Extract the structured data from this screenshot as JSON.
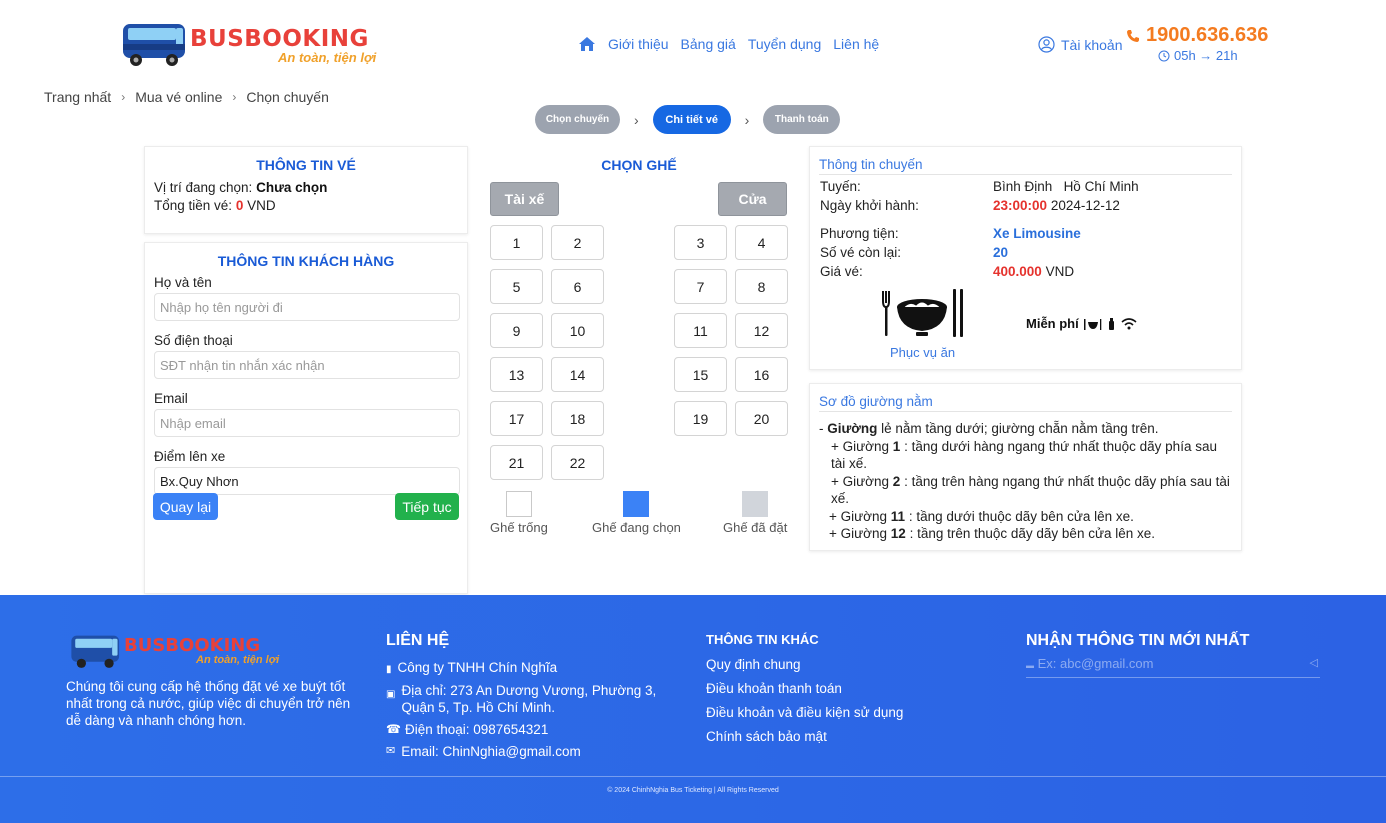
{
  "header": {
    "logo_text": "BUSBOOKING",
    "logo_tagline": "An toàn, tiện lợi",
    "nav": [
      "Giới thiệu",
      "Bảng giá",
      "Tuyển dụng",
      "Liên hệ"
    ],
    "account": "Tài khoản",
    "hotline": "1900.636.636",
    "hours": "05h → 21h"
  },
  "breadcrumb": [
    "Trang nhất",
    "Mua vé online",
    "Chọn chuyến"
  ],
  "steps": [
    "Chọn chuyến",
    "Chi tiết vé",
    "Thanh toán"
  ],
  "ticket_info": {
    "title": "THÔNG TIN VÉ",
    "position_label": "Vị trí đang chọn:",
    "position_value": "Chưa chọn",
    "total_label": "Tổng tiền vé:",
    "total_value": "0",
    "total_unit": "VND"
  },
  "customer": {
    "title": "THÔNG TIN KHÁCH HÀNG",
    "name_label": "Họ và tên",
    "name_placeholder": "Nhập họ tên người đi",
    "phone_label": "Số điện thoại",
    "phone_placeholder": "SĐT nhận tin nhắn xác nhận",
    "email_label": "Email",
    "email_placeholder": "Nhập email",
    "pickup_label": "Điểm lên xe",
    "pickup_value": "Bx.Quy Nhơn",
    "back_button": "Quay lại",
    "next_button": "Tiếp tục"
  },
  "seats": {
    "title": "CHỌN GHẾ",
    "driver": "Tài xế",
    "door": "Cửa",
    "numbers": [
      "1",
      "2",
      "3",
      "4",
      "5",
      "6",
      "7",
      "8",
      "9",
      "10",
      "11",
      "12",
      "13",
      "14",
      "15",
      "16",
      "17",
      "18",
      "19",
      "20",
      "21",
      "22"
    ],
    "legend": [
      {
        "label": "Ghế trống",
        "color": "#ffffff"
      },
      {
        "label": "Ghế đang chọn",
        "color": "#3b82f6"
      },
      {
        "label": "Ghế đã đặt",
        "color": "#d1d5db"
      }
    ]
  },
  "trip": {
    "title": "Thông tin chuyến",
    "route_label": "Tuyến:",
    "route_from": "Bình Định",
    "route_to": "Hồ Chí Minh",
    "date_label": "Ngày khởi hành:",
    "time": "23:00:00",
    "date": "2024-12-12",
    "vehicle_label": "Phương tiện:",
    "vehicle": "Xe Limousine",
    "remaining_label": "Số vé còn lại:",
    "remaining": "20",
    "price_label": "Giá vé:",
    "price": "400.000",
    "price_unit": "VND",
    "meal_caption": "Phục vụ ăn",
    "free_label": "Miễn phí"
  },
  "bed_map": {
    "title": "Sơ đồ giường nằm",
    "lines": [
      {
        "prefix": "- ",
        "bold": "Giường",
        "rest": " lẻ nằm tầng dưới; giường chẵn nằm tầng trên."
      },
      {
        "prefix": "+ Giường ",
        "bold": "1",
        "rest": " : tầng dưới hàng ngang thứ nhất thuộc dãy phía sau tài xế."
      },
      {
        "prefix": "+ Giường ",
        "bold": "2",
        "rest": " : tầng trên hàng ngang thứ nhất thuộc dãy phía sau tài xế."
      },
      {
        "prefix": "+ Giường ",
        "bold": "11",
        "rest": " : tầng dưới thuộc dãy bên cửa lên xe."
      },
      {
        "prefix": "+ Giường ",
        "bold": "12",
        "rest": " : tầng trên thuộc dãy dãy bên cửa lên xe."
      }
    ]
  },
  "footer": {
    "logo_text": "BUSBOOKING",
    "logo_tagline": "An toàn, tiện lợi",
    "about": "Chúng tôi cung cấp hệ thống đặt vé xe buýt tốt nhất trong cả nước, giúp việc di chuyển trở nên dễ dàng và nhanh chóng hơn.",
    "contact_title": "LIÊN HỆ",
    "company": "Công ty TNHH Chín Nghĩa",
    "address": "Địa chỉ: 273 An Dương Vương, Phường 3, Quận 5, Tp. Hồ Chí Minh.",
    "phone": "Điện thoại: 0987654321",
    "email": "Email: ChinNghia@gmail.com",
    "other_title": "THÔNG TIN KHÁC",
    "links": [
      "Quy định chung",
      "Điều khoản thanh toán",
      "Điều khoản và điều kiện sử dụng",
      "Chính sách bảo mật"
    ],
    "newsletter_title": "NHẬN THÔNG TIN MỚI NHẤT",
    "newsletter_placeholder": "Ex: abc@gmail.com",
    "copyright": "© 2024 ChinhNghia Bus Ticketing | All Rights Reserved"
  },
  "colors": {
    "primary": "#1668e3",
    "accent_orange": "#f47b20",
    "brand_red": "#e8413a",
    "success": "#22b14c"
  }
}
